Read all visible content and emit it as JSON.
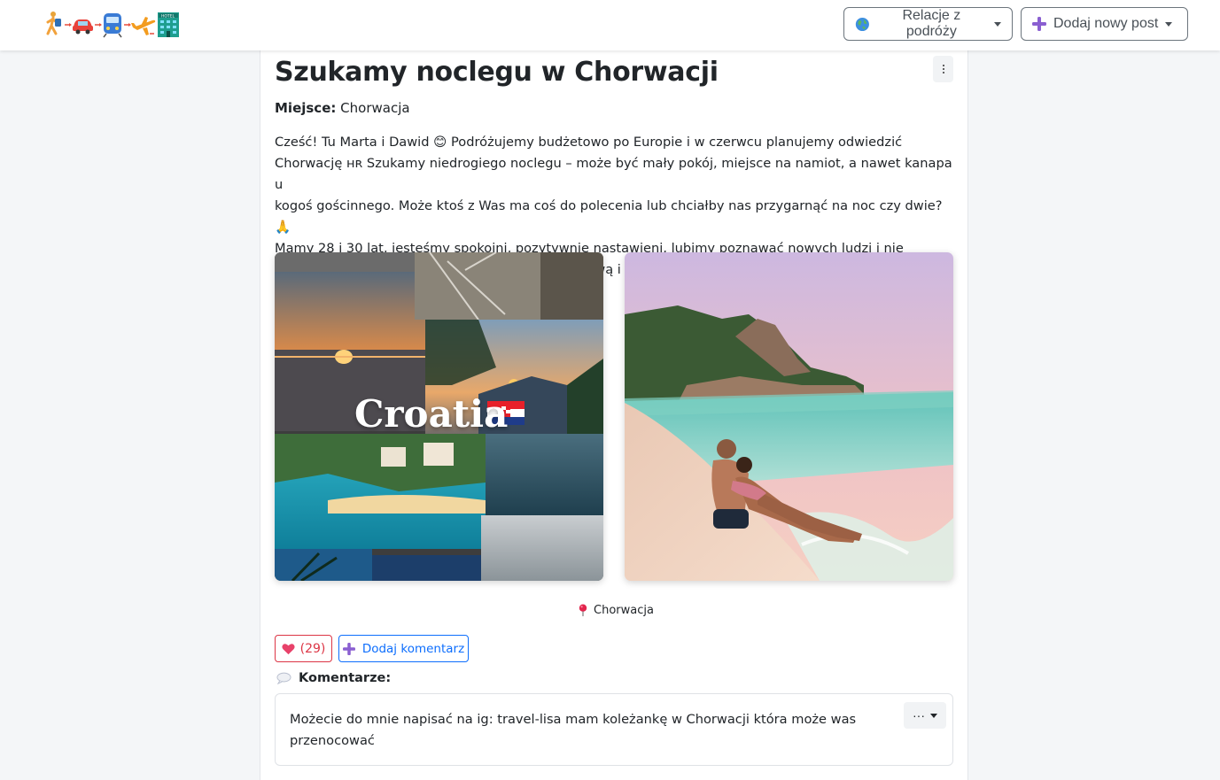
{
  "nav": {
    "logo_alt": "hitchhiker-car-train-plane-hotel-logo",
    "travel_reports_label": "Relacje z podróży",
    "add_post_label": "Dodaj nowy post"
  },
  "post": {
    "title": "Szukamy noclegu w Chorwacji",
    "place_label": "Miejsce:",
    "place_value": "Chorwacja",
    "body_line1": "Cześć! Tu Marta i Dawid 😊  Podróżujemy budżetowo po Europie i w czerwcu planujemy odwiedzić",
    "body_line2": "Chorwację ʜʀ Szukamy niedrogiego noclegu – może być mały pokój, miejsce na namiot, a nawet kanapa u",
    "body_line3": "kogoś gościnnego. Może ktoś z Was ma coś do polecenia lub chciałby nas przygarnąć na noc czy dwie? 🙏",
    "body_line4": "Mamy 28 i 30 lat, jesteśmy spokojni, pozytywnie nastawieni, lubimy poznawać nowych ludzi i nie",
    "body_line5": "potrzebujemy luksusów – wystarczy dach nad głową i dobra energia! 😜",
    "image1_caption": "Croatia",
    "location": "Chorwacja",
    "likes": "(29)",
    "add_comment_label": "Dodaj komentarz",
    "comments_heading": "Komentarze:"
  },
  "comments": [
    {
      "line1": "Możecie do mnie napisać na ig: travel-lisa mam koleżankę w Chorwacji która może was",
      "line2": "przenocować",
      "menu_label": "···"
    }
  ],
  "colors": {
    "like": "#dc3545",
    "comment": "#0d6efd",
    "background": "#f4f6f8"
  }
}
